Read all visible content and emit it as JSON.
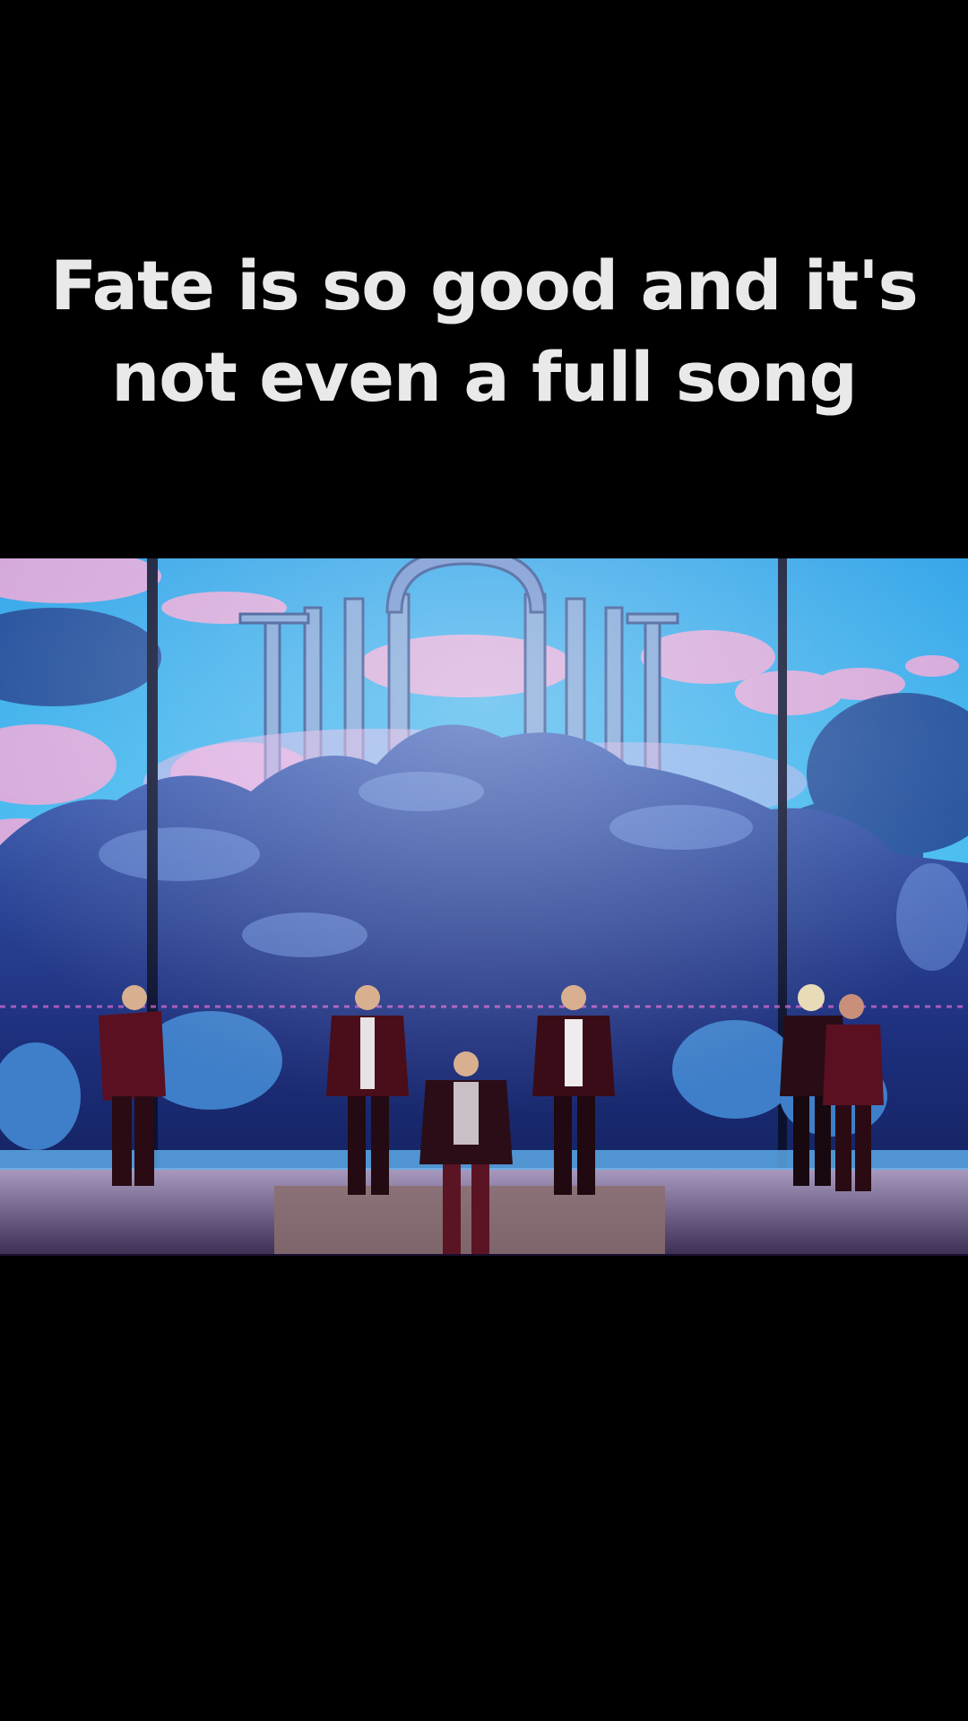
{
  "caption": {
    "line1": "Fate is so good and it's",
    "line2": "not even a full song"
  },
  "video": {
    "content": "stage performance",
    "colors": {
      "sky": "#3fb6ef",
      "sky_deep": "#1d5fbf",
      "cloud": "#e8a9d6",
      "rock": "#1c2f7a",
      "rock_light": "#4a6fc8",
      "stage": "#6b5c84",
      "costume": "#5a1020"
    }
  }
}
